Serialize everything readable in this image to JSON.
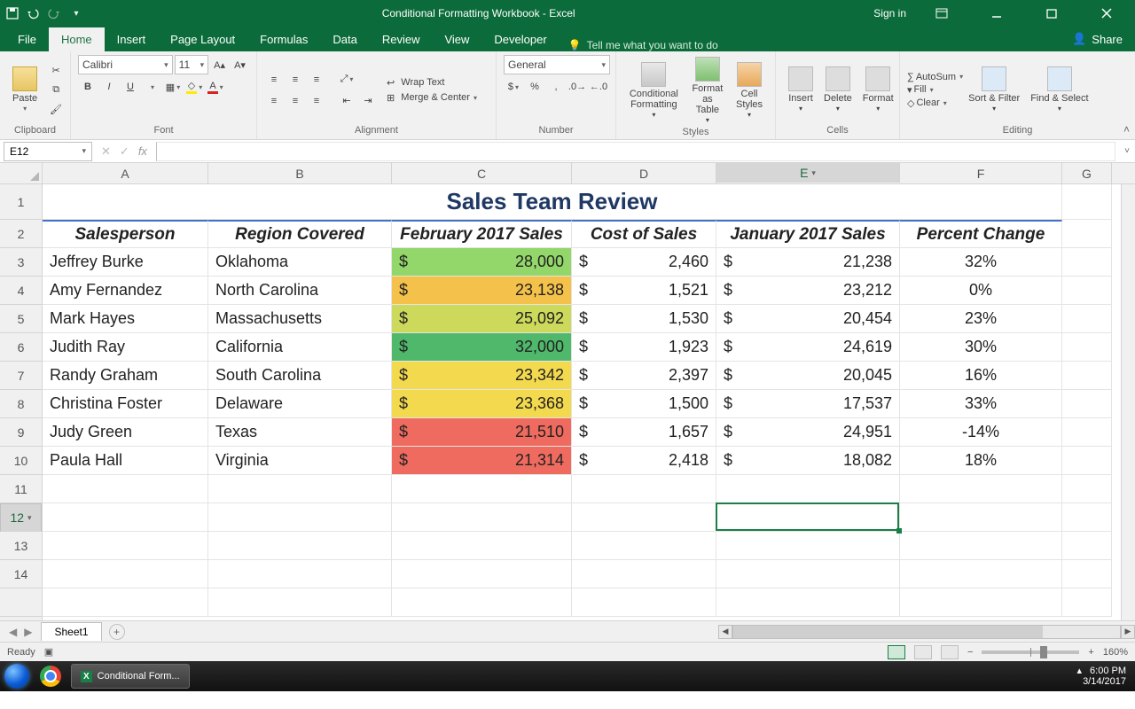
{
  "titlebar": {
    "title": "Conditional Formatting Workbook  -  Excel",
    "signin": "Sign in"
  },
  "tabs": {
    "file": "File",
    "home": "Home",
    "insert": "Insert",
    "pagelayout": "Page Layout",
    "formulas": "Formulas",
    "data": "Data",
    "review": "Review",
    "view": "View",
    "developer": "Developer",
    "tellme": "Tell me what you want to do",
    "share": "Share"
  },
  "ribbon": {
    "clipboard": {
      "label": "Clipboard",
      "paste": "Paste"
    },
    "font": {
      "label": "Font",
      "name": "Calibri",
      "size": "11"
    },
    "alignment": {
      "label": "Alignment",
      "wrap": "Wrap Text",
      "merge": "Merge & Center"
    },
    "number": {
      "label": "Number",
      "format": "General"
    },
    "styles": {
      "label": "Styles",
      "cond": "Conditional Formatting",
      "table": "Format as Table",
      "cell": "Cell Styles"
    },
    "cells": {
      "label": "Cells",
      "insert": "Insert",
      "delete": "Delete",
      "format": "Format"
    },
    "editing": {
      "label": "Editing",
      "autosum": "AutoSum",
      "fill": "Fill",
      "clear": "Clear",
      "sort": "Sort & Filter",
      "find": "Find & Select"
    }
  },
  "namebox": "E12",
  "columns": [
    "A",
    "B",
    "C",
    "D",
    "E",
    "F",
    "G"
  ],
  "rows_visible": 14,
  "row1_title": "Sales Team Review",
  "headers": {
    "A": "Salesperson",
    "B": "Region Covered",
    "C": "February 2017 Sales",
    "D": "Cost of Sales",
    "E": "January 2017 Sales",
    "F": "Percent Change"
  },
  "chart_data": {
    "type": "table",
    "title": "Sales Team Review",
    "columns": [
      "Salesperson",
      "Region Covered",
      "February 2017 Sales",
      "Cost of Sales",
      "January 2017 Sales",
      "Percent Change"
    ],
    "rows": [
      {
        "sp": "Jeffrey Burke",
        "reg": "Oklahoma",
        "feb": 28000,
        "cost": 2460,
        "jan": 21238,
        "pct": "32%",
        "color": "#93d66a"
      },
      {
        "sp": "Amy Fernandez",
        "reg": "North Carolina",
        "feb": 23138,
        "cost": 1521,
        "jan": 23212,
        "pct": "0%",
        "color": "#f4c24b"
      },
      {
        "sp": "Mark Hayes",
        "reg": "Massachusetts",
        "feb": 25092,
        "cost": 1530,
        "jan": 20454,
        "pct": "23%",
        "color": "#cdd95a"
      },
      {
        "sp": "Judith Ray",
        "reg": "California",
        "feb": 32000,
        "cost": 1923,
        "jan": 24619,
        "pct": "30%",
        "color": "#4fb86b"
      },
      {
        "sp": "Randy Graham",
        "reg": "South Carolina",
        "feb": 23342,
        "cost": 2397,
        "jan": 20045,
        "pct": "16%",
        "color": "#f3d94e"
      },
      {
        "sp": "Christina Foster",
        "reg": "Delaware",
        "feb": 23368,
        "cost": 1500,
        "jan": 17537,
        "pct": "33%",
        "color": "#f3d94e"
      },
      {
        "sp": "Judy Green",
        "reg": "Texas",
        "feb": 21510,
        "cost": 1657,
        "jan": 24951,
        "pct": "-14%",
        "color": "#ef6b5f"
      },
      {
        "sp": "Paula Hall",
        "reg": "Virginia",
        "feb": 21314,
        "cost": 2418,
        "jan": 18082,
        "pct": "18%",
        "color": "#ef6b5f"
      }
    ]
  },
  "sheet": {
    "name": "Sheet1"
  },
  "status": {
    "ready": "Ready",
    "zoom": "160%"
  },
  "taskbar": {
    "app": "Conditional Form...",
    "time": "6:00 PM",
    "date": "3/14/2017"
  }
}
